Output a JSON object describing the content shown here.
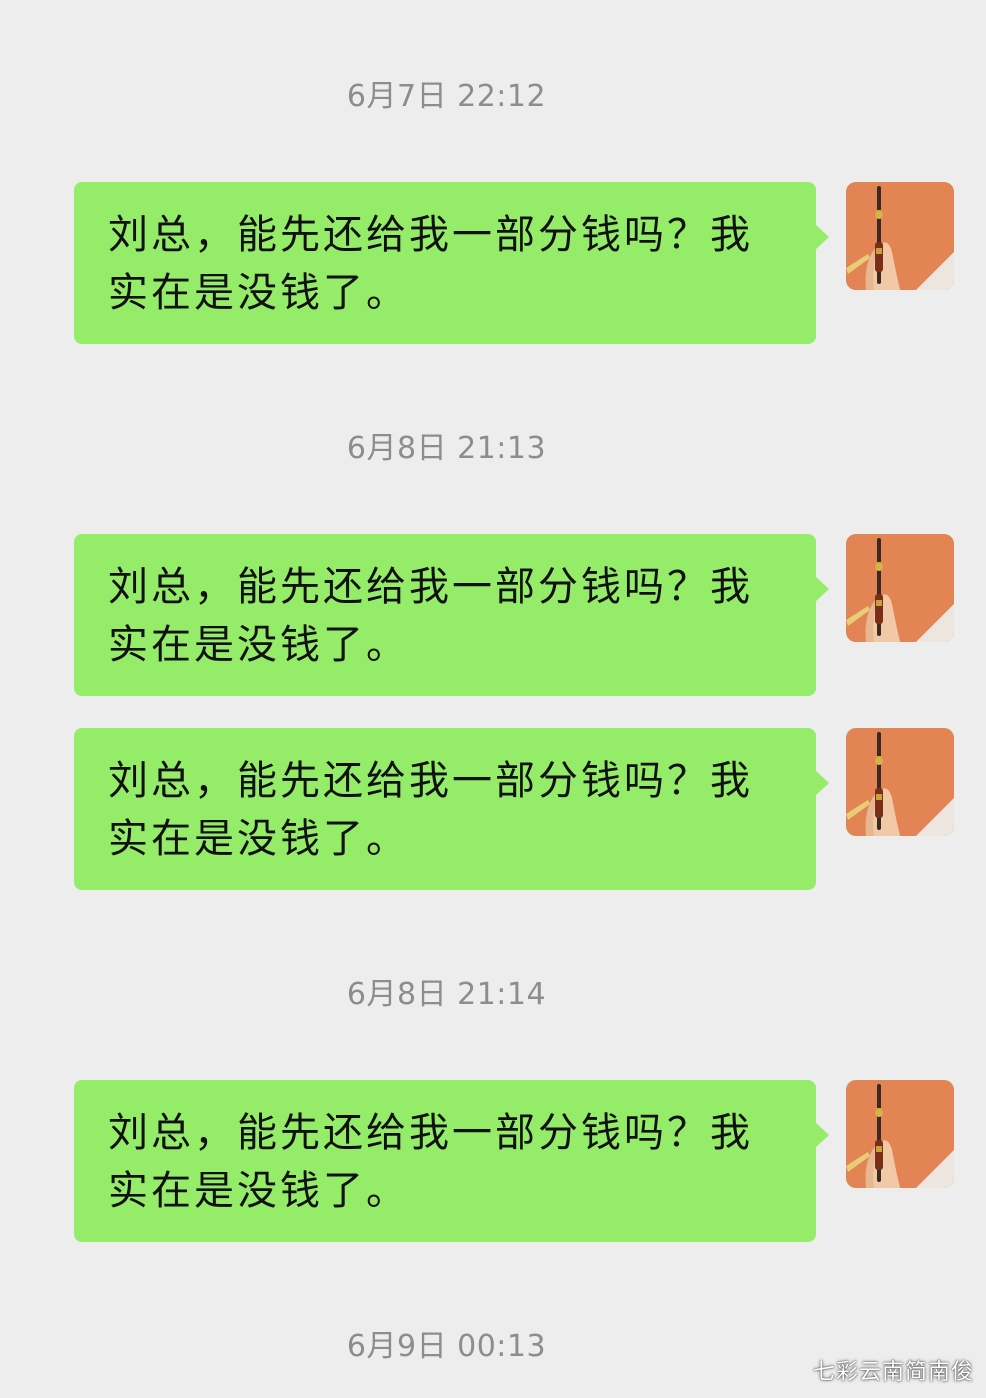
{
  "chat": {
    "message_text": "刘总，能先还给我一部分钱吗？我实在是没钱了。",
    "timestamps": [
      "6月7日 22:12",
      "6月8日 21:13",
      "6月8日 21:14",
      "6月9日 00:13"
    ],
    "messages": [
      {
        "text": "刘总，能先还给我一部分钱吗？我实在是没钱了。"
      },
      {
        "text": "刘总，能先还给我一部分钱吗？我实在是没钱了。"
      },
      {
        "text": "刘总，能先还给我一部分钱吗？我实在是没钱了。"
      },
      {
        "text": "刘总，能先还给我一部分钱吗？我实在是没钱了。"
      }
    ]
  },
  "avatar": {
    "icon": "avatar-hand-holding-pen",
    "background_color": "#e07f4f"
  },
  "colors": {
    "page_background": "#ededed",
    "bubble_green": "#95ec69",
    "timestamp_gray": "#8d8d8d"
  },
  "watermark": {
    "text": "七彩云南简南俊"
  }
}
